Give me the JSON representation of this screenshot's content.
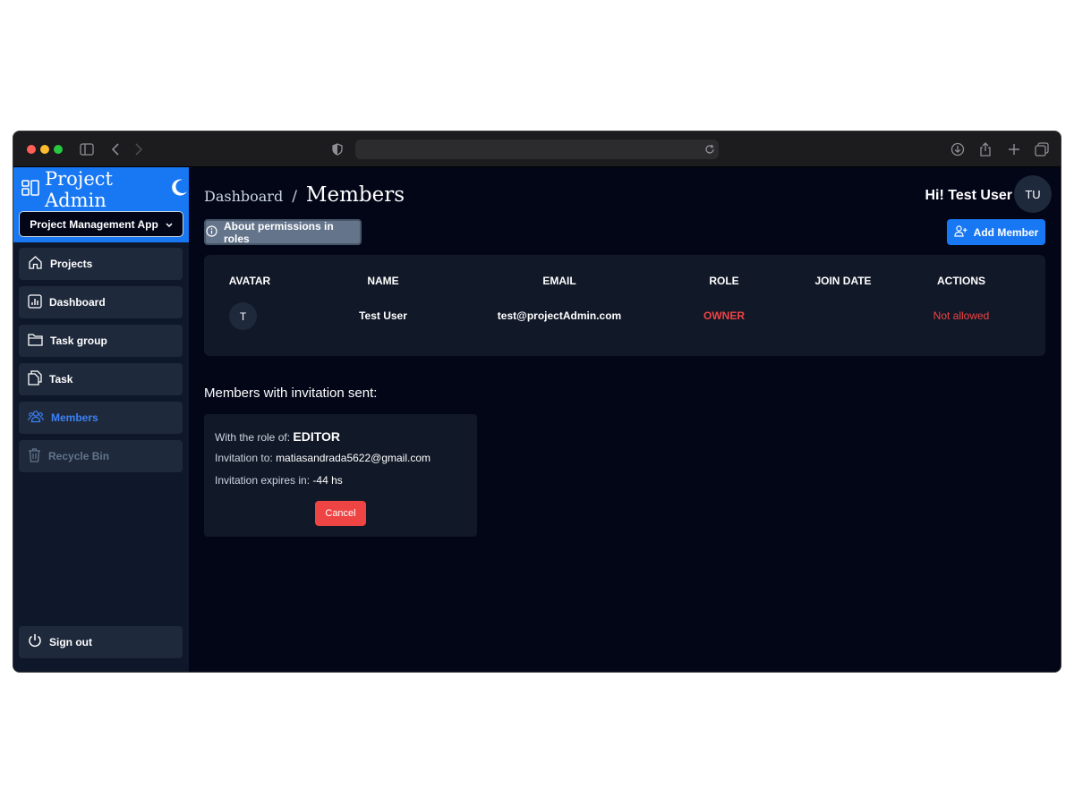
{
  "browser": {
    "traffic_lights": [
      "#ff5f57",
      "#febc2e",
      "#28c840"
    ],
    "icons": [
      "sidebar-toggle-icon",
      "back-icon",
      "forward-icon",
      "shield-icon",
      "reload-icon",
      "download-icon",
      "share-icon",
      "new-tab-icon",
      "tabs-overview-icon"
    ]
  },
  "sidebar": {
    "brand": "Project Admin",
    "brand_icon": "layout-icon",
    "theme_icon": "moon-icon",
    "project_selector": "Project Management App",
    "items": [
      {
        "label": "Projects",
        "icon": "home-icon"
      },
      {
        "label": "Dashboard",
        "icon": "chart-icon"
      },
      {
        "label": "Task group",
        "icon": "folder-icon"
      },
      {
        "label": "Task",
        "icon": "copy-icon"
      },
      {
        "label": "Members",
        "icon": "users-icon"
      },
      {
        "label": "Recycle Bin",
        "icon": "trash-icon"
      }
    ],
    "sign_out": "Sign out"
  },
  "header": {
    "breadcrumb_parent": "Dashboard",
    "breadcrumb_separator": "/",
    "breadcrumb_current": "Members",
    "greeting": "Hi! Test User",
    "avatar_initials": "TU"
  },
  "toolbar": {
    "about_label": "About permissions in roles",
    "add_member_label": "Add Member"
  },
  "members_table": {
    "columns": [
      "AVATAR",
      "NAME",
      "EMAIL",
      "ROLE",
      "JOIN DATE",
      "ACTIONS"
    ],
    "rows": [
      {
        "avatar": "T",
        "name": "Test User",
        "email": "test@projectAdmin.com",
        "role": "OWNER",
        "join_date": "",
        "actions": "Not allowed"
      }
    ]
  },
  "invitations": {
    "heading": "Members with invitation sent:",
    "items": [
      {
        "role_label": "With the role of:",
        "role": "EDITOR",
        "to_label": "Invitation to:",
        "to": "matiasandrada5622@gmail.com",
        "expires_label": "Invitation expires in:",
        "expires": "-44 hs",
        "cancel_label": "Cancel"
      }
    ]
  },
  "colors": {
    "accent": "#1877f2",
    "danger": "#ef4444",
    "active_nav": "#3b82f6",
    "background": "#020617",
    "surface": "#111827"
  }
}
